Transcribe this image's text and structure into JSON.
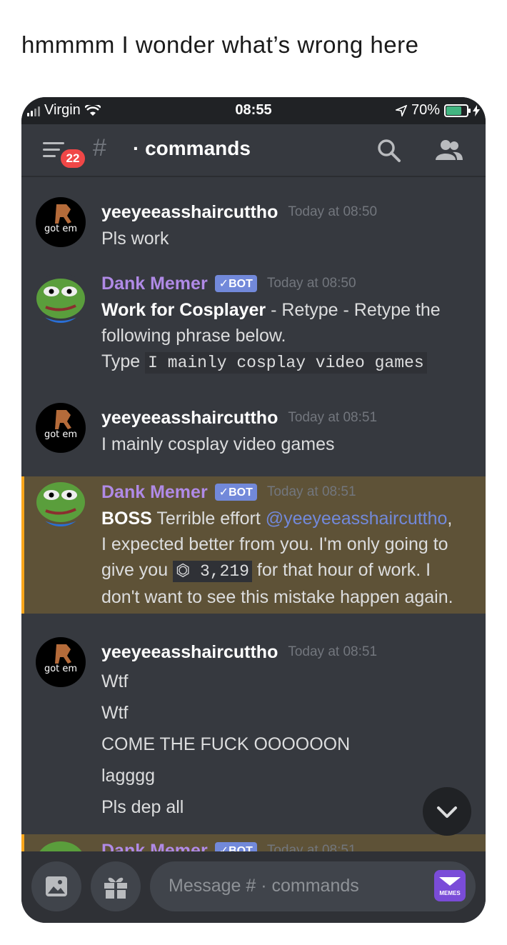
{
  "caption": "hmmmm I wonder what’s wrong here",
  "status_bar": {
    "carrier": "Virgin",
    "time": "08:55",
    "battery": "70%",
    "battery_level": 0.7
  },
  "header": {
    "badge_count": "22",
    "hash": "#",
    "channel_name": "· commands"
  },
  "messages": [
    {
      "username": "yeeyeeasshaircuttho",
      "avatar_text": "got em",
      "timestamp": "Today at 08:50",
      "lines": [
        "Pls work"
      ]
    },
    {
      "username": "Dank Memer",
      "bot_label": "✓BOT",
      "timestamp": "Today at 08:50",
      "line1_bold": "Work for Cosplayer",
      "line1_rest": " - Retype - Retype the",
      "line2": "following phrase below.",
      "line3_prefix": "Type ",
      "line3_code": "I mainly cosplay video games"
    },
    {
      "username": "yeeyeeasshaircuttho",
      "avatar_text": "got em",
      "timestamp": "Today at 08:51",
      "lines": [
        "I mainly cosplay video games"
      ]
    },
    {
      "username": "Dank Memer",
      "bot_label": "✓BOT",
      "timestamp": "Today at 08:51",
      "bold": "BOSS",
      "text1": " Terrible effort ",
      "mention": "@yeeyeeasshaircuttho",
      "text2": ",",
      "line2": "I expected better from you. I'm only going to",
      "line3_prefix": "give you ",
      "amount": "⏣ 3,219",
      "line3_suffix": " for that hour of work. I",
      "line4": "don't want to see this mistake happen again."
    },
    {
      "username": "yeeyeeasshaircuttho",
      "avatar_text": "got em",
      "timestamp": "Today at 08:51",
      "lines": [
        "Wtf",
        "Wtf",
        "COME THE FUCK OOOOOON",
        "lagggg",
        "Pls dep all"
      ]
    },
    {
      "username": "Dank Memer",
      "bot_label": "✓BOT",
      "timestamp": "Today at 08:51"
    }
  ],
  "composer": {
    "placeholder": "Message # · commands",
    "memes_label": "MEMES"
  },
  "icons": [
    "menu-icon",
    "search-icon",
    "members-icon",
    "image-icon",
    "gift-icon",
    "chevron-down-icon",
    "memes-icon"
  ],
  "colors": {
    "background": "#36393f",
    "bot_name": "#b08ae6",
    "highlight": "#5e5237",
    "mention": "#7289da",
    "badge": "#f04747"
  }
}
